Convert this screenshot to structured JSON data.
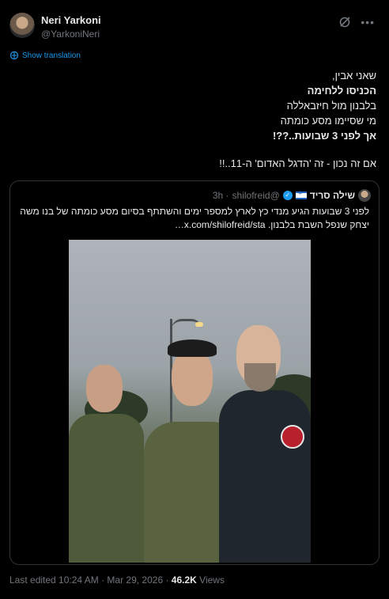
{
  "author": {
    "name": "Neri Yarkoni",
    "handle": "@YarkoniNeri"
  },
  "translate_label": "Show translation",
  "tweet_lines": [
    "שאני אבין,",
    "הכניסו ללחימה",
    "בלבנון מול חיזבאללה",
    "מי שסיימו מסע כומתה",
    "אך לפני 3 שבועות..??!",
    "",
    "אם זה נכון - זה 'הדגל האדום' ה-11..!!"
  ],
  "quote": {
    "name": "שילה סריד",
    "handle": "@shilofreid",
    "time": "· 3h",
    "text": "לפני 3 שבועות הגיע מנדי כץ לארץ למספר ימים והשתתף בסיום מסע כומתה של בנו משה יצחק שנפל השבת בלבנון. x.com/shilofreid/sta…"
  },
  "footer": {
    "edited": "Last edited 10:24 AM · Mar 29, 2026 · ",
    "views_count": "46.2K",
    "views_label": " Views"
  },
  "colors": {
    "link": "#1d9bf0",
    "muted": "#71767b",
    "text": "#e7e9ea",
    "border": "#2f3336"
  }
}
